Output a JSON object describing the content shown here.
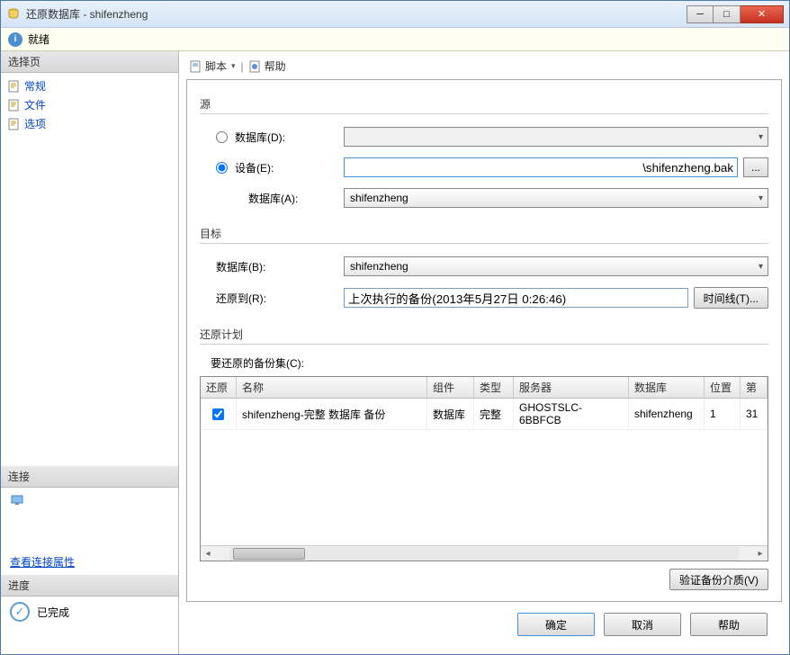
{
  "window": {
    "title": "还原数据库 - shifenzheng"
  },
  "status": {
    "text": "就绪"
  },
  "sidebar": {
    "pages_header": "选择页",
    "items": [
      {
        "label": "常规"
      },
      {
        "label": "文件"
      },
      {
        "label": "选项"
      }
    ],
    "connection_header": "连接",
    "view_connection_props": "查看连接属性",
    "progress_header": "进度",
    "progress_status": "已完成"
  },
  "toolbar": {
    "script": "脚本",
    "help": "帮助"
  },
  "source": {
    "group": "源",
    "database_radio": "数据库(D):",
    "device_radio": "设备(E):",
    "device_path": "\\shifenzheng.bak",
    "db_label": "数据库(A):",
    "db_value": "shifenzheng"
  },
  "target": {
    "group": "目标",
    "db_label": "数据库(B):",
    "db_value": "shifenzheng",
    "restore_to_label": "还原到(R):",
    "restore_to_value": "上次执行的备份(2013年5月27日 0:26:46)",
    "timeline_btn": "时间线(T)..."
  },
  "plan": {
    "group": "还原计划",
    "backupsets_label": "要还原的备份集(C):",
    "columns": {
      "restore": "还原",
      "name": "名称",
      "component": "组件",
      "type": "类型",
      "server": "服务器",
      "database": "数据库",
      "position": "位置",
      "first": "第"
    },
    "rows": [
      {
        "restore": true,
        "name": "shifenzheng-完整 数据库 备份",
        "component": "数据库",
        "type": "完整",
        "server": "GHOSTSLC-6BBFCB",
        "database": "shifenzheng",
        "position": "1",
        "first": "31"
      }
    ],
    "verify_btn": "验证备份介质(V)"
  },
  "footer": {
    "ok": "确定",
    "cancel": "取消",
    "help": "帮助"
  },
  "browse_ellipsis": "..."
}
